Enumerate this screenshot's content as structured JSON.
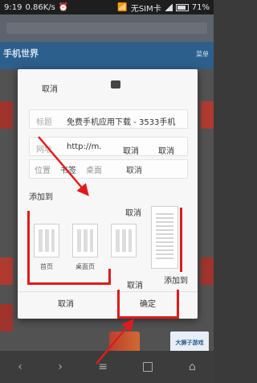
{
  "status_bar": {
    "time": "9:19",
    "speed": "0.86K/s",
    "carrier": "无SIM卡",
    "battery": "71%"
  },
  "background": {
    "site_logo": "手机世界",
    "menu_label": "菜单",
    "ad_text": "大狮子游戏"
  },
  "dialog": {
    "top_cancel": "取消",
    "title_label": "标题",
    "title_value": "免费手机应用下载 - 3533手机",
    "url_label": "网址",
    "url_value": "http://m.",
    "url_cancel_1": "取消",
    "url_cancel_2": "取消",
    "position_label": "位置",
    "position_tab_bookmark": "书签",
    "position_tab_home": "桌面",
    "position_cancel": "取消",
    "add_to_label": "添加到",
    "cancel_above_options": "取消",
    "options": [
      {
        "label": "首页"
      },
      {
        "label": "桌面页"
      },
      {
        "label": ""
      },
      {
        "label": ""
      }
    ],
    "cancel_below_options": "取消",
    "add_to_secondary": "添加到",
    "cancel_button": "取消",
    "confirm_button": "确定"
  },
  "colors": {
    "annotation_red": "#e01b1b",
    "header_blue": "#2d5f8c"
  }
}
